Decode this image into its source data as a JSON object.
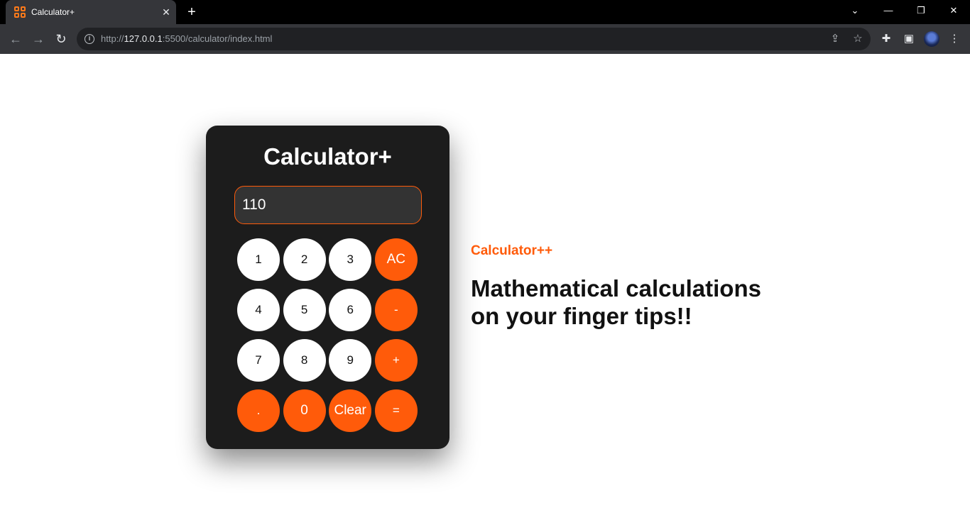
{
  "browser": {
    "tab_title": "Calculator+",
    "tab_close": "✕",
    "new_tab": "+",
    "url_prefix": "http://",
    "url_host": "127.0.0.1",
    "url_rest": ":5500/calculator/index.html",
    "window_controls": [
      "⌄",
      "—",
      "❐",
      "✕"
    ]
  },
  "calculator": {
    "title": "Calculator+",
    "display_value": "110",
    "keys": [
      {
        "label": "1",
        "kind": "num"
      },
      {
        "label": "2",
        "kind": "num"
      },
      {
        "label": "3",
        "kind": "num"
      },
      {
        "label": "AC",
        "kind": "op"
      },
      {
        "label": "4",
        "kind": "num"
      },
      {
        "label": "5",
        "kind": "num"
      },
      {
        "label": "6",
        "kind": "num"
      },
      {
        "label": "-",
        "kind": "op"
      },
      {
        "label": "7",
        "kind": "num"
      },
      {
        "label": "8",
        "kind": "num"
      },
      {
        "label": "9",
        "kind": "num"
      },
      {
        "label": "+",
        "kind": "op"
      },
      {
        "label": ".",
        "kind": "op"
      },
      {
        "label": "0",
        "kind": "op"
      },
      {
        "label": "Clear",
        "kind": "op"
      },
      {
        "label": "=",
        "kind": "op"
      }
    ]
  },
  "hero": {
    "brand": "Calculator++",
    "tagline_line1": "Mathematical calculations",
    "tagline_line2": "on your finger tips!!"
  },
  "colors": {
    "accent": "#ff5b0a",
    "panel": "#1c1c1c",
    "display_bg": "#333333"
  }
}
